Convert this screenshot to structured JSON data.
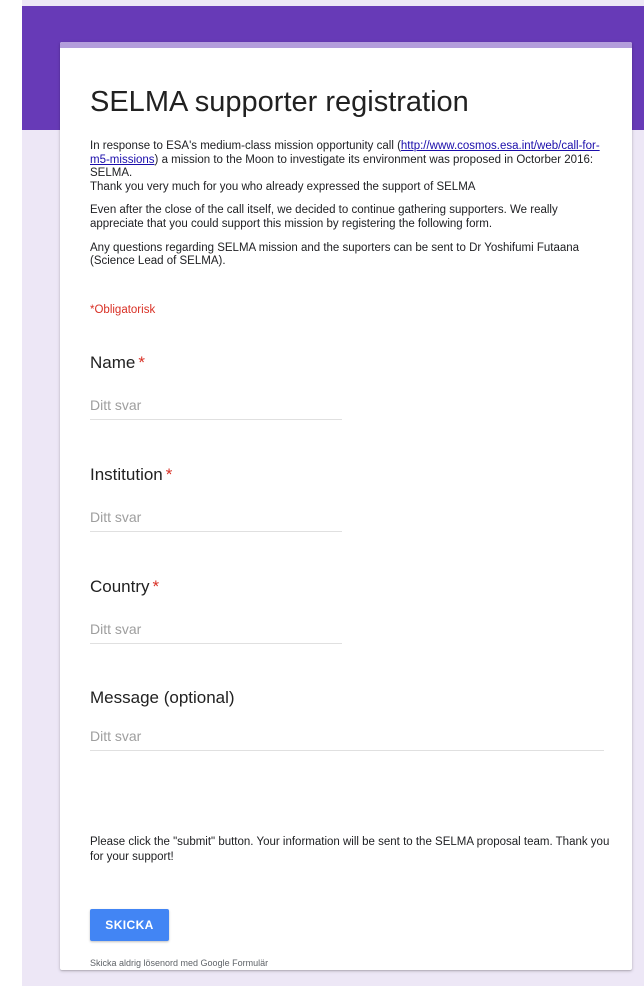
{
  "form": {
    "title": "SELMA supporter registration",
    "description": {
      "intro_before_link": " In response to ESA's medium-class mission opportunity call (",
      "link_text": "http://www.cosmos.esa.int/web/call-for-m5-missions",
      "intro_after_link": ") a mission to the Moon to investigate its environment was proposed in Octorber 2016: SELMA.",
      "thanks": "Thank you very much for you who already expressed the support of SELMA",
      "paragraph2": "Even after the close of the call itself, we decided to continue gathering supporters.  We really appreciate that you could support this mission by registering the following form.",
      "paragraph3": "Any questions regarding SELMA mission and the suporters can be sent to Dr Yoshifumi Futaana (Science Lead of SELMA)."
    },
    "required_note": "*Obligatorisk",
    "questions": [
      {
        "label": "Name",
        "required_mark": "*",
        "placeholder": "Ditt svar"
      },
      {
        "label": "Institution",
        "required_mark": "*",
        "placeholder": "Ditt svar"
      },
      {
        "label": "Country",
        "required_mark": "*",
        "placeholder": "Ditt svar"
      },
      {
        "label": "Message (optional)",
        "required_mark": "",
        "placeholder": "Ditt svar"
      }
    ],
    "closing_text": "Please click the \"submit\" button. Your information will be sent to the SELMA proposal team.  Thank you for your support!",
    "submit_label": "SKICKA",
    "footer_note": "Skicka aldrig lösenord med Google Formulär"
  },
  "colors": {
    "header": "#673ab7",
    "background": "#ede7f6",
    "accent_bar": "#b39ddb",
    "required": "#d93025",
    "button": "#4285f4"
  }
}
